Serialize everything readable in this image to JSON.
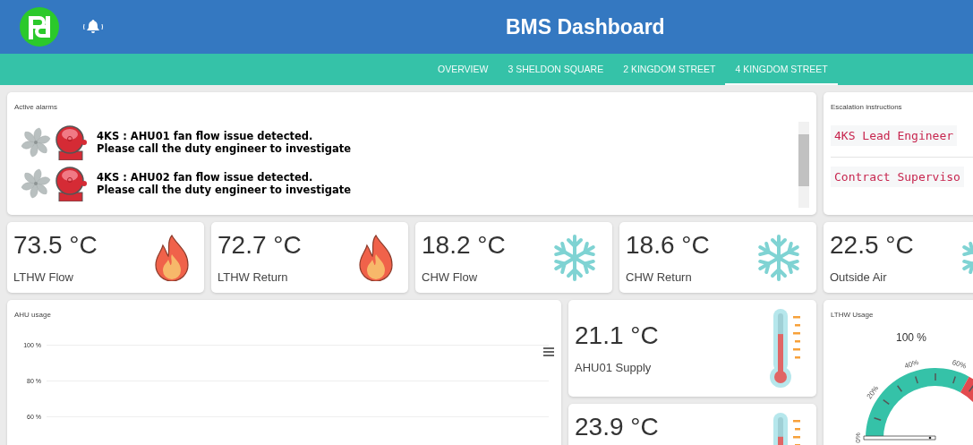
{
  "header": {
    "title": "BMS Dashboard"
  },
  "tabs": [
    {
      "label": "OVERVIEW",
      "selected": false
    },
    {
      "label": "3 SHELDON SQUARE",
      "selected": false
    },
    {
      "label": "2 KINGDOM STREET",
      "selected": false
    },
    {
      "label": "4 KINGDOM STREET",
      "selected": true
    }
  ],
  "active_alarms": {
    "title": "Active alarms",
    "alarms": [
      {
        "line_1": "4KS : AHU01 fan flow issue detected.",
        "line_2": "Please call the duty engineer to investigate"
      },
      {
        "line_1": "4KS : AHU02 fan flow issue detected.",
        "line_2": "Please call the duty engineer to investigate"
      }
    ]
  },
  "escalation": {
    "title": "Escalation instructions",
    "contacts": [
      "4KS Lead Engineer",
      "Contract Superviso"
    ]
  },
  "tiles": [
    {
      "value": "73.5 °C",
      "label": "LTHW Flow",
      "kind": "flame"
    },
    {
      "value": "72.7 °C",
      "label": "LTHW Return",
      "kind": "flame"
    },
    {
      "value": "18.2 °C",
      "label": "CHW Flow",
      "kind": "snowflake"
    },
    {
      "value": "18.6 °C",
      "label": "CHW Return",
      "kind": "snowflake"
    },
    {
      "value": "22.5 °C",
      "label": "Outside Air",
      "kind": "snowflake"
    }
  ],
  "ahu_usage": {
    "title": "AHU usage",
    "y_axis_labels": [
      "100 %",
      "80 %",
      "60 %"
    ]
  },
  "supply_temps": [
    {
      "value": "21.1 °C",
      "label": "AHU01 Supply",
      "level": 0.65
    },
    {
      "value": "23.9 °C",
      "level": 0.67
    }
  ],
  "lthw_usage": {
    "title": "LTHW Usage",
    "reading": "100 %",
    "tick_labels": [
      "0%",
      "20%",
      "40%",
      "60%"
    ]
  }
}
